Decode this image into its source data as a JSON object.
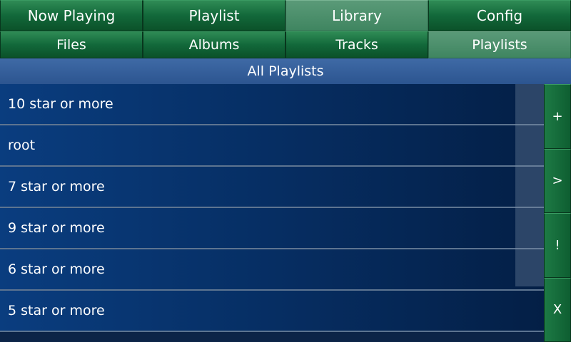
{
  "main_tabs": [
    {
      "label": "Now Playing"
    },
    {
      "label": "Playlist"
    },
    {
      "label": "Library"
    },
    {
      "label": "Config"
    }
  ],
  "main_tabs_active": "Library",
  "sub_tabs": [
    {
      "label": "Files"
    },
    {
      "label": "Albums"
    },
    {
      "label": "Tracks"
    },
    {
      "label": "Playlists"
    }
  ],
  "sub_tabs_active": "Playlists",
  "header": {
    "title": "All Playlists"
  },
  "playlists": [
    {
      "name": "10 star or more"
    },
    {
      "name": "root"
    },
    {
      "name": "7 star or more"
    },
    {
      "name": "9 star or more"
    },
    {
      "name": "6 star or more"
    },
    {
      "name": "5 star or more"
    }
  ],
  "side_buttons": {
    "add": "+",
    "play": ">",
    "info": "!",
    "remove": "X"
  }
}
